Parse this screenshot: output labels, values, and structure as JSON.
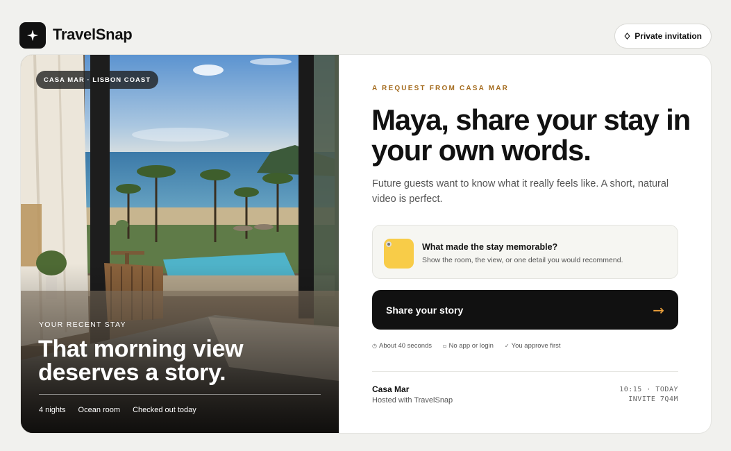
{
  "header": {
    "brand": "TravelSnap",
    "logo_icon": "sparkle-icon",
    "invite_label": "Private invitation",
    "invite_icon": "diamond-icon"
  },
  "hero": {
    "badge": "CASA MAR · LISBON COAST",
    "kicker": "YOUR RECENT STAY",
    "title": "That morning view deserves a story.",
    "meta": [
      "4 nights",
      "Ocean room",
      "Checked out today"
    ]
  },
  "panel": {
    "eyebrow": "A REQUEST FROM CASA MAR",
    "headline": "Maya, share your stay in your own words.",
    "subtext": "Future guests want to know what it really feels like. A short, natural video is perfect.",
    "prompt": {
      "title": "What made the stay memorable?",
      "subtitle": "Show the room, the view, or one detail you would recommend.",
      "icon_color": "#f8cc48"
    },
    "cta": {
      "label": "Share your story",
      "arrow": "→",
      "arrow_color": "#f0a33c"
    },
    "features": [
      {
        "icon": "clock-icon",
        "glyph": "◷",
        "label": "About 40 seconds"
      },
      {
        "icon": "square-icon",
        "glyph": "▫",
        "label": "No app or login"
      },
      {
        "icon": "check-icon",
        "glyph": "✓",
        "label": "You approve first"
      }
    ],
    "host": {
      "name": "Casa Mar",
      "subtitle": "Hosted with TravelSnap",
      "time": "10:15 · TODAY",
      "invite_code": "INVITE 7Q4M"
    }
  },
  "colors": {
    "background": "#f1f1ee",
    "accent": "#a46b1e",
    "cta_bg": "#111111"
  }
}
